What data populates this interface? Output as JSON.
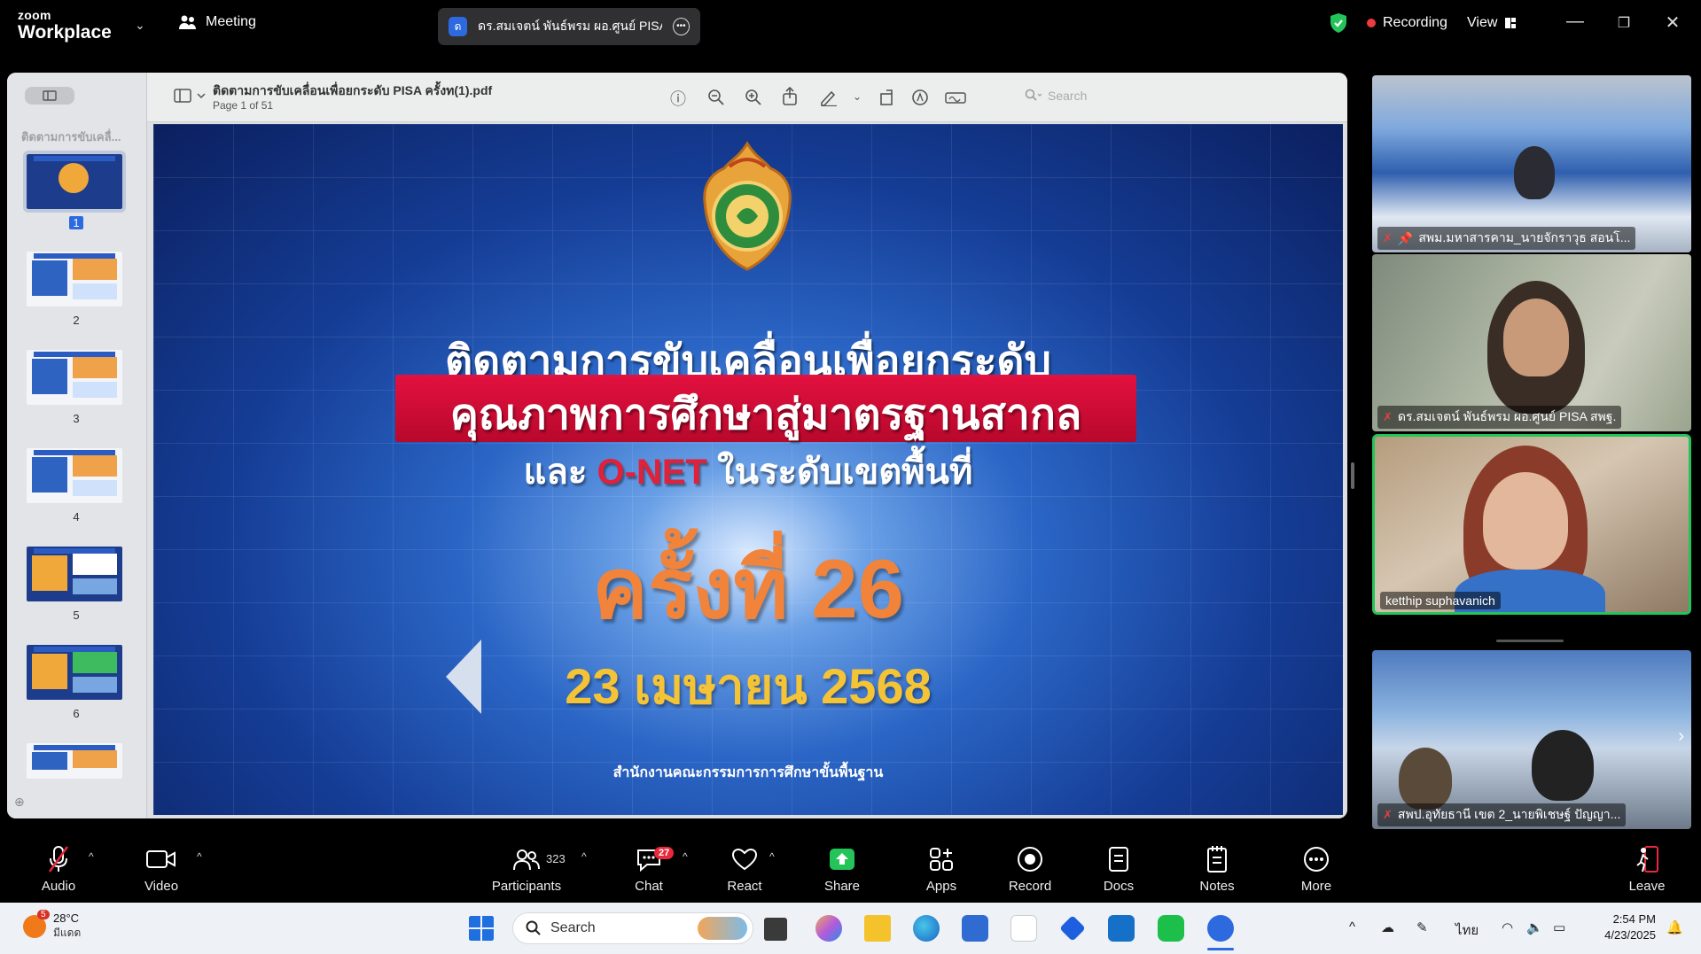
{
  "topbar": {
    "brand_small": "zoom",
    "brand_big": "Workplace",
    "meeting_label": "Meeting",
    "speaker_initial": "ด",
    "speaker_name": "ดร.สมเจตน์ พันธ์พรม ผอ.ศูนย์ PISA ส",
    "recording_label": "Recording",
    "view_label": "View"
  },
  "pdf": {
    "filename": "ติดตามการขับเคลื่อนเพื่อยกระดับ PISA ครั้งท(1).pdf",
    "page_info": "Page 1 of 51",
    "search_placeholder": "Search",
    "sidebar_title": "ติดตามการขับเคลื่...",
    "thumbnails": [
      "1",
      "2",
      "3",
      "4",
      "5",
      "6"
    ]
  },
  "slide": {
    "line1": "ติดตามการขับเคลื่อนเพื่อยกระดับ",
    "line2": "คุณภาพการศึกษาสู่มาตรฐานสากล",
    "line3_a": "และ",
    "line3_onet": "O-NET",
    "line3_b": "ในระดับเขตพื้นที่",
    "round": "ครั้งที่ 26",
    "date": "23  เมษายน  2568",
    "footer": "สำนักงานคณะกรรมการการศึกษาขั้นพื้นฐาน"
  },
  "participants": [
    {
      "name": "สพม.มหาสารคาม_นายจักราวุธ สอนโ..."
    },
    {
      "name": "ดร.สมเจตน์ พันธ์พรม ผอ.ศูนย์ PISA สพฐ."
    },
    {
      "name": "ketthip suphavanich"
    },
    {
      "name": "สพป.อุทัยธานี เขต 2_นายพิเชษฐ์ ปัญญา..."
    }
  ],
  "toolbar": {
    "audio": "Audio",
    "video": "Video",
    "participants": "Participants",
    "participants_count": "323",
    "chat": "Chat",
    "chat_badge": "27",
    "react": "React",
    "share": "Share",
    "apps": "Apps",
    "record": "Record",
    "docs": "Docs",
    "notes": "Notes",
    "more": "More",
    "leave": "Leave"
  },
  "taskbar": {
    "weather_badge": "5",
    "temp": "28°C",
    "condition": "มีแดด",
    "search": "Search",
    "lang": "ไทย",
    "time": "2:54 PM",
    "date": "4/23/2025"
  },
  "colors": {
    "accent_blue": "#2d6ae0",
    "record_red": "#ee3b3b",
    "share_green": "#24c45b",
    "active_speaker_border": "#24c45b"
  }
}
